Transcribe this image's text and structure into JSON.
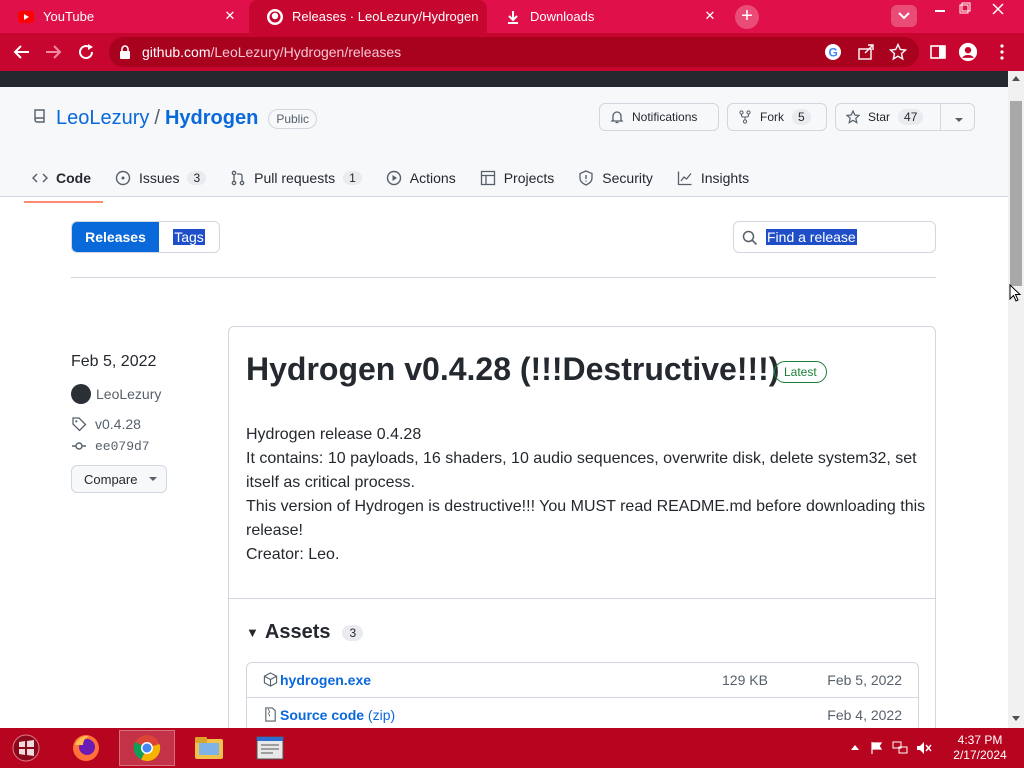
{
  "browser": {
    "tabs": [
      {
        "title": "YouTube",
        "active": false
      },
      {
        "title": "Releases · LeoLezury/Hydrogen",
        "active": true
      },
      {
        "title": "Downloads",
        "active": false
      }
    ],
    "new_tab_label": "+",
    "url_host": "github.com",
    "url_path": "/LeoLezury/Hydrogen/releases"
  },
  "repo": {
    "owner": "LeoLezury",
    "separator": "/",
    "name": "Hydrogen",
    "visibility": "Public",
    "notifications_label": "Notifications",
    "fork_label": "Fork",
    "fork_count": "5",
    "star_label": "Star",
    "star_count": "47"
  },
  "nav": [
    {
      "label": "Code",
      "icon": "code-icon",
      "count": ""
    },
    {
      "label": "Issues",
      "icon": "issue-icon",
      "count": "3"
    },
    {
      "label": "Pull requests",
      "icon": "pull-request-icon",
      "count": "1"
    },
    {
      "label": "Actions",
      "icon": "play-icon",
      "count": ""
    },
    {
      "label": "Projects",
      "icon": "table-icon",
      "count": ""
    },
    {
      "label": "Security",
      "icon": "shield-icon",
      "count": ""
    },
    {
      "label": "Insights",
      "icon": "graph-icon",
      "count": ""
    }
  ],
  "releases_page": {
    "releases_tab": "Releases",
    "tags_tab": "Tags",
    "search_placeholder": "Find a release"
  },
  "release": {
    "date": "Feb 5, 2022",
    "author": "LeoLezury",
    "tag": "v0.4.28",
    "commit": "ee079d7",
    "compare_label": "Compare",
    "title": "Hydrogen v0.4.28 (!!!Destructive!!!)",
    "latest_badge": "Latest",
    "body_lines": [
      "Hydrogen release 0.4.28",
      "It contains: 10 payloads, 16 shaders, 10 audio sequences, overwrite disk, delete system32, set itself as critical process.",
      "This version of Hydrogen is destructive!!! You MUST read README.md before downloading this release!",
      "Creator: Leo."
    ],
    "assets_label": "Assets",
    "assets_count": "3",
    "assets": [
      {
        "name": "hydrogen.exe",
        "suffix": "",
        "size": "129 KB",
        "date": "Feb 5, 2022"
      },
      {
        "name": "Source code",
        "suffix": "(zip)",
        "size": "",
        "date": "Feb 4, 2022"
      }
    ]
  },
  "taskbar": {
    "time": "4:37 PM",
    "date": "2/17/2024"
  },
  "colors": {
    "browser_frame": "#e0114a",
    "toolbar": "#c6062e",
    "link": "#0969da",
    "primary_button": "#0969da",
    "latest_green": "#1a7f37",
    "taskbar": "#b7051f"
  }
}
